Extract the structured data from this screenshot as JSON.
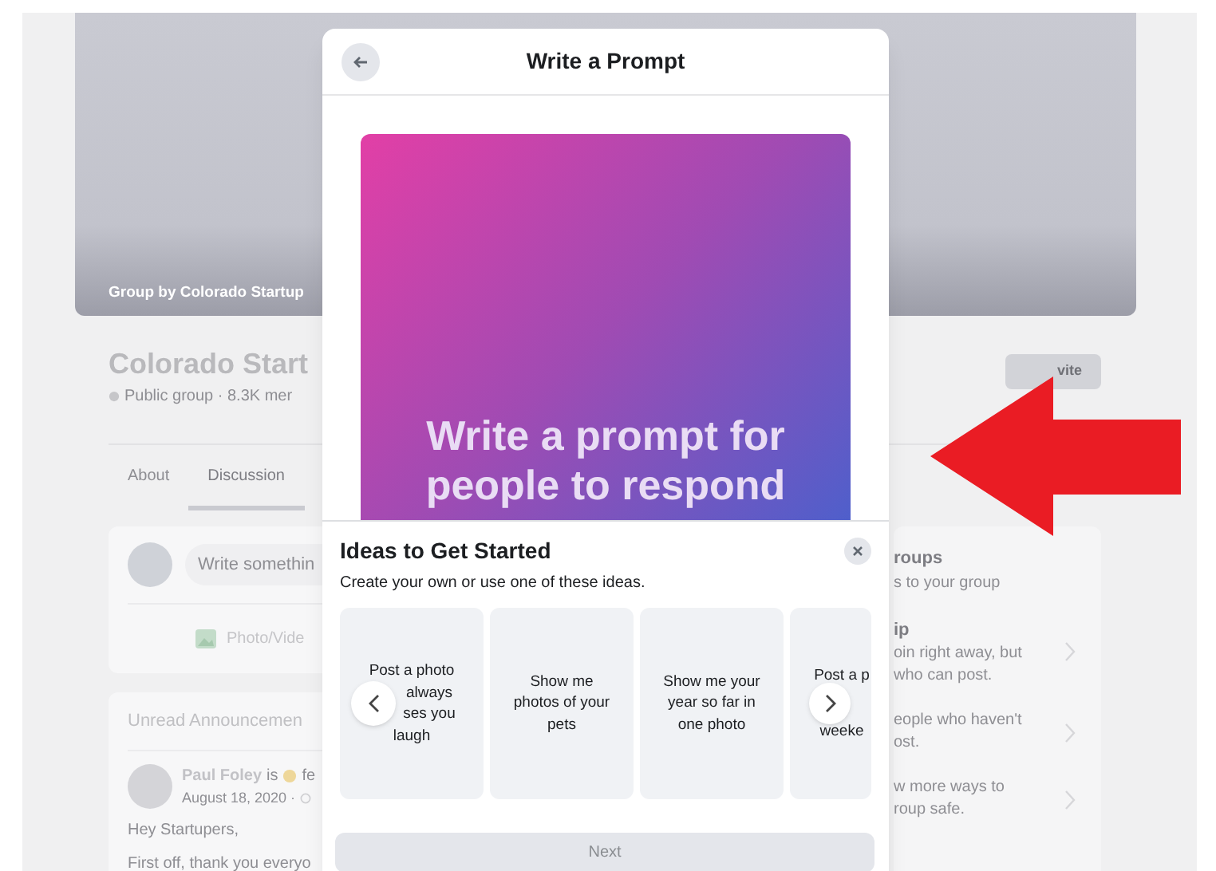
{
  "background": {
    "cover_caption": "Group by Colorado Startup",
    "group_name": "Colorado Start",
    "group_meta": "Public group · 8.3K mer",
    "invite_button": "vite",
    "tabs": [
      {
        "label": "About",
        "selected": false
      },
      {
        "label": "Discussion",
        "selected": true
      }
    ],
    "composer": {
      "placeholder": "Write somethin",
      "action": "Photo/Vide"
    },
    "announcements": {
      "title": "Unread Announcemen",
      "author": "Paul Foley",
      "status": "is",
      "status_tail": "fe",
      "date": "August 18, 2020 ·",
      "lines": [
        "Hey Startupers,",
        "First off, thank you everyo"
      ]
    },
    "sidebar": {
      "items": [
        {
          "title": "roups",
          "text": [
            "s to your group"
          ],
          "chevron": false
        },
        {
          "title": "ip",
          "text": [
            "oin right away, but",
            "who can post."
          ],
          "chevron": true
        },
        {
          "text": [
            "eople who haven't",
            "ost."
          ],
          "chevron": true
        },
        {
          "text": [
            "w more ways to",
            "roup safe."
          ],
          "chevron": true
        }
      ]
    }
  },
  "modal": {
    "title": "Write a Prompt",
    "prompt_card": {
      "text": "Write a prompt for people to respond"
    },
    "ideas": {
      "title": "Ideas to Get Started",
      "subtitle": "Create your own or use one of these ideas.",
      "cards": [
        {
          "lines": [
            "Post a photo",
            "always",
            "ses you",
            "laugh"
          ]
        },
        {
          "lines": [
            "Show me",
            "photos of your",
            "pets"
          ]
        },
        {
          "lines": [
            "Show me your",
            "year so far in",
            "one photo"
          ]
        },
        {
          "lines": [
            "Post a p",
            "weeke"
          ]
        }
      ]
    },
    "next_button": {
      "label": "Next",
      "disabled": true
    }
  }
}
